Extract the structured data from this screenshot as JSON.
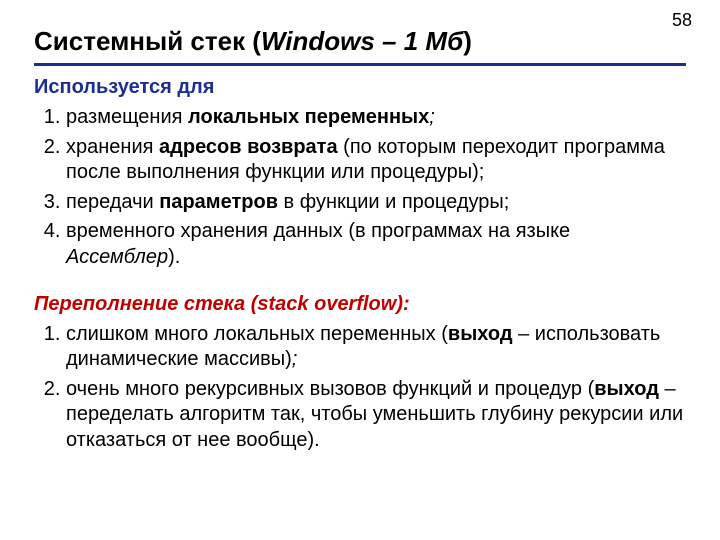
{
  "page_number": "58",
  "title_main": "Системный стек (",
  "title_paren": "Windows – 1 Мб",
  "title_close": ")",
  "section1": {
    "heading": "Используется для",
    "items": {
      "i1a": "размещения ",
      "i1b": "локальных переменных",
      "i1c": ";",
      "i2a": "хранения ",
      "i2b": "адресов возврата",
      "i2c": " (по которым переходит программа после выполнения функции или процедуры);",
      "i3a": "передачи ",
      "i3b": "параметров",
      "i3c": " в функции и процедуры;",
      "i4a": "временного хранения данных (в программах на языке ",
      "i4b": "Ассемблер",
      "i4c": ")."
    }
  },
  "section2": {
    "heading": "Переполнение стека (stack overflow):",
    "items": {
      "i1a": "слишком много локальных переменных (",
      "i1b": "выход",
      "i1c": " – использовать динамические массивы)",
      "i1d": ";",
      "i2a": "очень много рекурсивных вызовов функций и процедур (",
      "i2b": "выход",
      "i2c": " – переделать алгоритм так, чтобы уменьшить глубину рекурсии или отказаться от нее вообще)."
    }
  }
}
